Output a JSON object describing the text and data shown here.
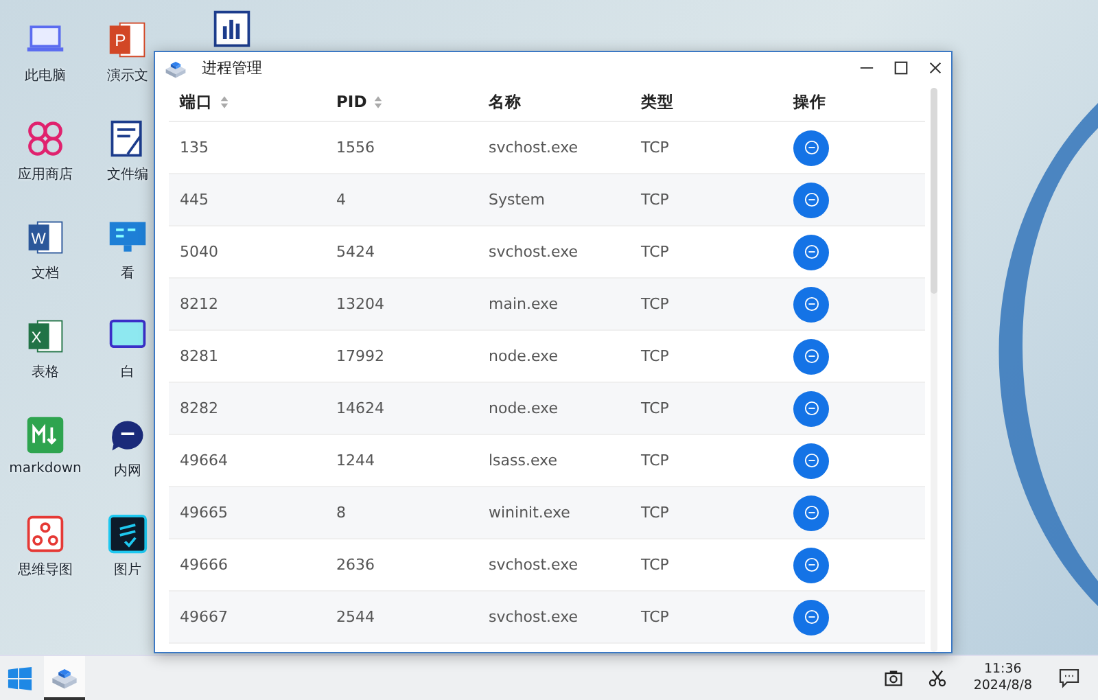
{
  "desktop": {
    "icons": [
      {
        "label": "此电脑"
      },
      {
        "label": "应用商店"
      },
      {
        "label": "文档",
        "glyph": "W"
      },
      {
        "label": "表格",
        "glyph": "X"
      },
      {
        "label": "markdown"
      },
      {
        "label": "思维导图"
      },
      {
        "label": "演示文",
        "glyph": "P"
      },
      {
        "label": "文件编"
      },
      {
        "label": "看"
      },
      {
        "label": "白"
      },
      {
        "label": "内网"
      },
      {
        "label": "图片"
      }
    ]
  },
  "window": {
    "title": "进程管理"
  },
  "table": {
    "columns": [
      {
        "label": "端口",
        "sortable": true
      },
      {
        "label": "PID",
        "sortable": true
      },
      {
        "label": "名称",
        "sortable": false
      },
      {
        "label": "类型",
        "sortable": false
      },
      {
        "label": "操作",
        "sortable": false
      }
    ],
    "rows": [
      {
        "port": "135",
        "pid": "1556",
        "name": "svchost.exe",
        "type": "TCP"
      },
      {
        "port": "445",
        "pid": "4",
        "name": "System",
        "type": "TCP"
      },
      {
        "port": "5040",
        "pid": "5424",
        "name": "svchost.exe",
        "type": "TCP"
      },
      {
        "port": "8212",
        "pid": "13204",
        "name": "main.exe",
        "type": "TCP"
      },
      {
        "port": "8281",
        "pid": "17992",
        "name": "node.exe",
        "type": "TCP"
      },
      {
        "port": "8282",
        "pid": "14624",
        "name": "node.exe",
        "type": "TCP"
      },
      {
        "port": "49664",
        "pid": "1244",
        "name": "lsass.exe",
        "type": "TCP"
      },
      {
        "port": "49665",
        "pid": "8",
        "name": "wininit.exe",
        "type": "TCP"
      },
      {
        "port": "49666",
        "pid": "2636",
        "name": "svchost.exe",
        "type": "TCP"
      },
      {
        "port": "49667",
        "pid": "2544",
        "name": "svchost.exe",
        "type": "TCP"
      }
    ]
  },
  "taskbar": {
    "time": "11:36",
    "date": "2024/8/8"
  }
}
